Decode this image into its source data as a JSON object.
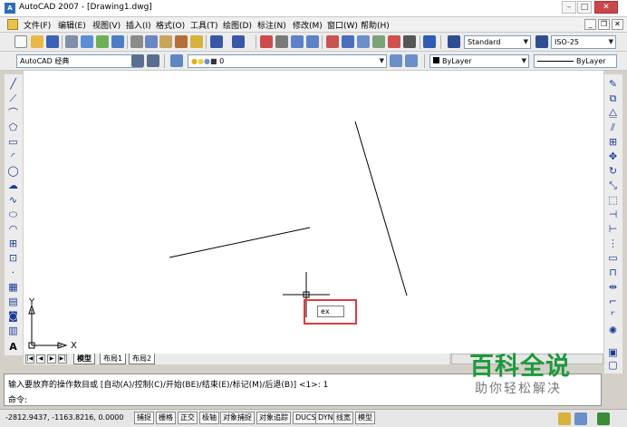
{
  "window": {
    "title": "AutoCAD 2007 - [Drawing1.dwg]",
    "icon_label": "A"
  },
  "menubar": {
    "items": [
      "文件(F)",
      "编辑(E)",
      "视图(V)",
      "插入(I)",
      "格式(O)",
      "工具(T)",
      "绘图(D)",
      "标注(N)",
      "修改(M)",
      "窗口(W)",
      "帮助(H)"
    ]
  },
  "toolbar1": {
    "text_style": "Standard",
    "dim_style": "ISO-25"
  },
  "toolbar2": {
    "workspace": "AutoCAD 经典",
    "layer": "0",
    "color": "ByLayer",
    "linetype": "ByLayer"
  },
  "canvas": {
    "background": "#ffffff",
    "ucs_x_label": "X",
    "ucs_y_label": "Y",
    "dynamic_input_value": "ex",
    "highlight_color": "#e03b3b"
  },
  "layout_tabs": {
    "tabs": [
      "模型",
      "布局1",
      "布局2"
    ]
  },
  "command_window": {
    "prompt_line": "输入要放弃的操作数目或 [自动(A)/控制(C)/开始(BE)/结束(E)/标记(M)/后退(B)] <1>: 1",
    "command_line": "命令:"
  },
  "statusbar": {
    "coordinates": "-2812.9437, -1163.8216, 0.0000",
    "toggles": [
      "捕捉",
      "栅格",
      "正交",
      "极轴",
      "对象捕捉",
      "对象追踪",
      "DUCS",
      "DYN",
      "线宽",
      "模型"
    ]
  },
  "watermark": {
    "main": "百科全说",
    "sub": "助你轻松解决"
  }
}
